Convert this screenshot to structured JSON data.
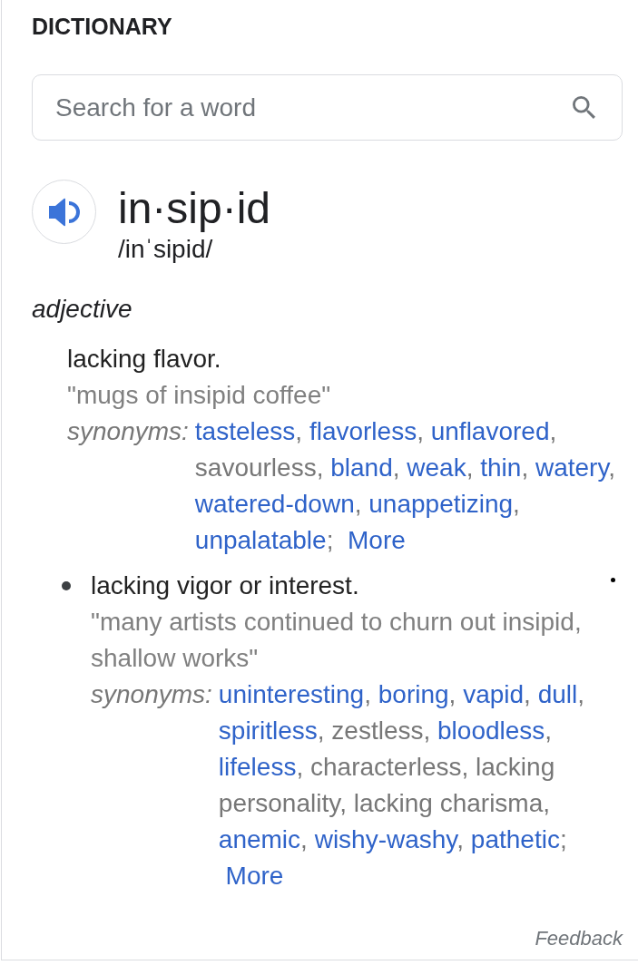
{
  "title": "DICTIONARY",
  "search": {
    "placeholder": "Search for a word"
  },
  "entry": {
    "word": "in·sip·id",
    "pronunciation": "/inˈsipid/"
  },
  "part_of_speech": "adjective",
  "senses": [
    {
      "bullet": false,
      "definition": "lacking flavor.",
      "example": "\"mugs of insipid coffee\"",
      "synonyms_label": "synonyms:",
      "synonyms": [
        {
          "text": "tasteless",
          "kind": "link",
          "punct": ","
        },
        {
          "text": "flavorless",
          "kind": "link",
          "punct": ","
        },
        {
          "text": "unflavored",
          "kind": "link",
          "punct": ","
        },
        {
          "text": "savourless",
          "kind": "text",
          "punct": ","
        },
        {
          "text": "bland",
          "kind": "link",
          "punct": ","
        },
        {
          "text": "weak",
          "kind": "link",
          "punct": ","
        },
        {
          "text": "thin",
          "kind": "link",
          "punct": ","
        },
        {
          "text": "watery",
          "kind": "link",
          "punct": ","
        },
        {
          "text": "watered-down",
          "kind": "link",
          "punct": ","
        },
        {
          "text": "unappetizing",
          "kind": "link",
          "punct": ","
        },
        {
          "text": "unpalatable",
          "kind": "link",
          "punct": ";"
        }
      ],
      "more": "More"
    },
    {
      "bullet": true,
      "definition": "lacking vigor or interest.",
      "example": "\"many artists continued to churn out insipid, shallow works\"",
      "synonyms_label": "synonyms:",
      "synonyms": [
        {
          "text": "uninteresting",
          "kind": "link",
          "punct": ","
        },
        {
          "text": "boring",
          "kind": "link",
          "punct": ","
        },
        {
          "text": "vapid",
          "kind": "link",
          "punct": ","
        },
        {
          "text": "dull",
          "kind": "link",
          "punct": ","
        },
        {
          "text": "spiritless",
          "kind": "link",
          "punct": ","
        },
        {
          "text": "zestless",
          "kind": "text",
          "punct": ","
        },
        {
          "text": "bloodless",
          "kind": "link",
          "punct": ","
        },
        {
          "text": "lifeless",
          "kind": "link",
          "punct": ","
        },
        {
          "text": "characterless",
          "kind": "text",
          "punct": ","
        },
        {
          "text": "lacking personality",
          "kind": "text",
          "punct": ","
        },
        {
          "text": "lacking charisma",
          "kind": "text",
          "punct": ","
        },
        {
          "text": "anemic",
          "kind": "link",
          "punct": ","
        },
        {
          "text": "wishy-washy",
          "kind": "link",
          "punct": ","
        },
        {
          "text": "pathetic",
          "kind": "link",
          "punct": ";"
        }
      ],
      "more": "More"
    }
  ],
  "feedback": "Feedback"
}
